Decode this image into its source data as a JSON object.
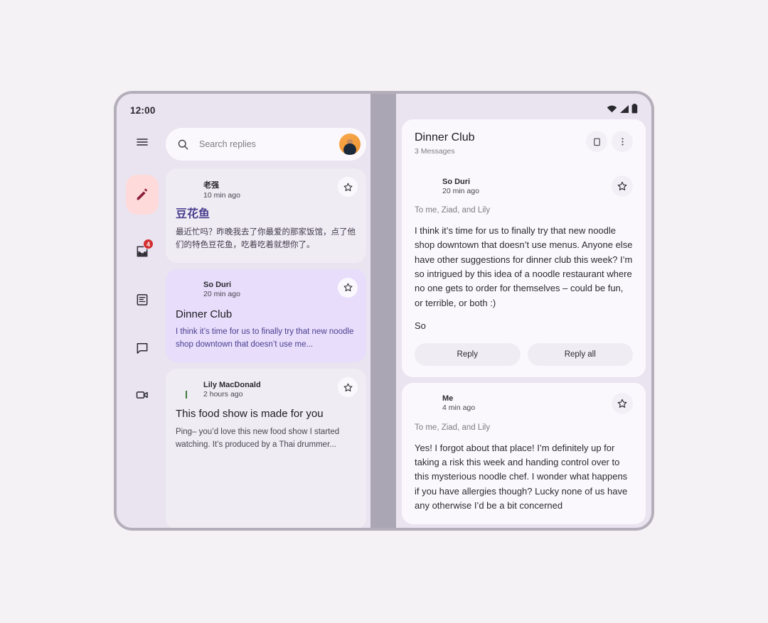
{
  "status_bar": {
    "time": "12:00",
    "icons": [
      "wifi-icon",
      "cellular-signal-icon",
      "battery-icon"
    ]
  },
  "nav_rail": {
    "items": [
      {
        "name": "menu",
        "icon": "hamburger-menu-icon",
        "label": "Menu",
        "badge": null,
        "active": false
      },
      {
        "name": "compose",
        "icon": "pencil-icon",
        "label": "Compose",
        "badge": null,
        "active": true
      },
      {
        "name": "inbox",
        "icon": "inbox-icon",
        "label": "Inbox",
        "badge": "4",
        "active": false
      },
      {
        "name": "articles",
        "icon": "article-icon",
        "label": "Articles",
        "badge": null,
        "active": false
      },
      {
        "name": "chat",
        "icon": "chat-bubble-icon",
        "label": "Chat",
        "badge": null,
        "active": false
      },
      {
        "name": "video",
        "icon": "video-camera-icon",
        "label": "Video",
        "badge": null,
        "active": false
      }
    ]
  },
  "search": {
    "placeholder": "Search replies",
    "value": "",
    "icon": "search-icon",
    "avatar": "account-avatar"
  },
  "message_list": [
    {
      "sender": "老强",
      "time": "10 min ago",
      "subject": "豆花鱼",
      "preview": "最近忙吗？昨晚我去了你最爱的那家饭馆，点了他们的特色豆花鱼，吃着吃着就想你了。",
      "selected": false,
      "cjk": true,
      "has_image": false,
      "starred": false,
      "avatar_style": "av-photo-a"
    },
    {
      "sender": "So Duri",
      "time": "20 min ago",
      "subject": "Dinner Club",
      "preview": "I think it’s time for us to finally try that new noodle shop downtown that doesn’t use me...",
      "selected": true,
      "cjk": false,
      "has_image": false,
      "starred": false,
      "avatar_style": "av-photo-b"
    },
    {
      "sender": "Lily MacDonald",
      "time": "2 hours ago",
      "subject": "This food show is made for you",
      "preview": "Ping– you’d love this new food show I started watching. It’s produced by a Thai drummer...",
      "selected": false,
      "cjk": false,
      "has_image": true,
      "image_alt": "cooking-show-thumbnail",
      "starred": false,
      "avatar_style": "av-flower"
    }
  ],
  "detail": {
    "thread_title": "Dinner Club",
    "message_count": "3 Messages",
    "header_actions": [
      {
        "name": "delete",
        "icon": "trash-icon",
        "label": "Delete"
      },
      {
        "name": "more",
        "icon": "more-vertical-icon",
        "label": "More options"
      }
    ],
    "messages": [
      {
        "sender": "So Duri",
        "time": "20 min ago",
        "recipients": "To me, Ziad, and Lily",
        "body": "I think it’s time for us to finally try that new noodle shop downtown that doesn’t use menus. Anyone else have other suggestions for dinner club this week? I’m so intrigued by this idea of a noodle restaurant where no one gets to order for themselves – could be fun, or terrible, or both :)",
        "signature": "So",
        "avatar_style": "av-photo-b",
        "starred": false,
        "actions": [
          {
            "name": "reply",
            "label": "Reply"
          },
          {
            "name": "reply-all",
            "label": "Reply all"
          }
        ]
      },
      {
        "sender": "Me",
        "time": "4 min ago",
        "recipients": "To me, Ziad, and Lily",
        "body": "Yes! I forgot about that place! I’m definitely up for taking a risk this week and handing control over to this mysterious noodle chef. I wonder what happens if you have allergies though? Lucky none of us have any otherwise I’d be a bit concerned",
        "signature": "",
        "avatar_style": "av-photo-me",
        "starred": false,
        "actions": []
      }
    ]
  },
  "colors": {
    "page_background": "#f4f2f5",
    "device_bezel": "#b3aeba",
    "surface": "#e9e4f0",
    "card": "#f0ecf4",
    "card_selected": "#e8ddfb",
    "card_white": "#fbf8fd",
    "accent_fab": "#ffdada",
    "accent_text": "#4a3f8f",
    "badge": "#d32f2f",
    "hinge": "#aba6b3"
  }
}
